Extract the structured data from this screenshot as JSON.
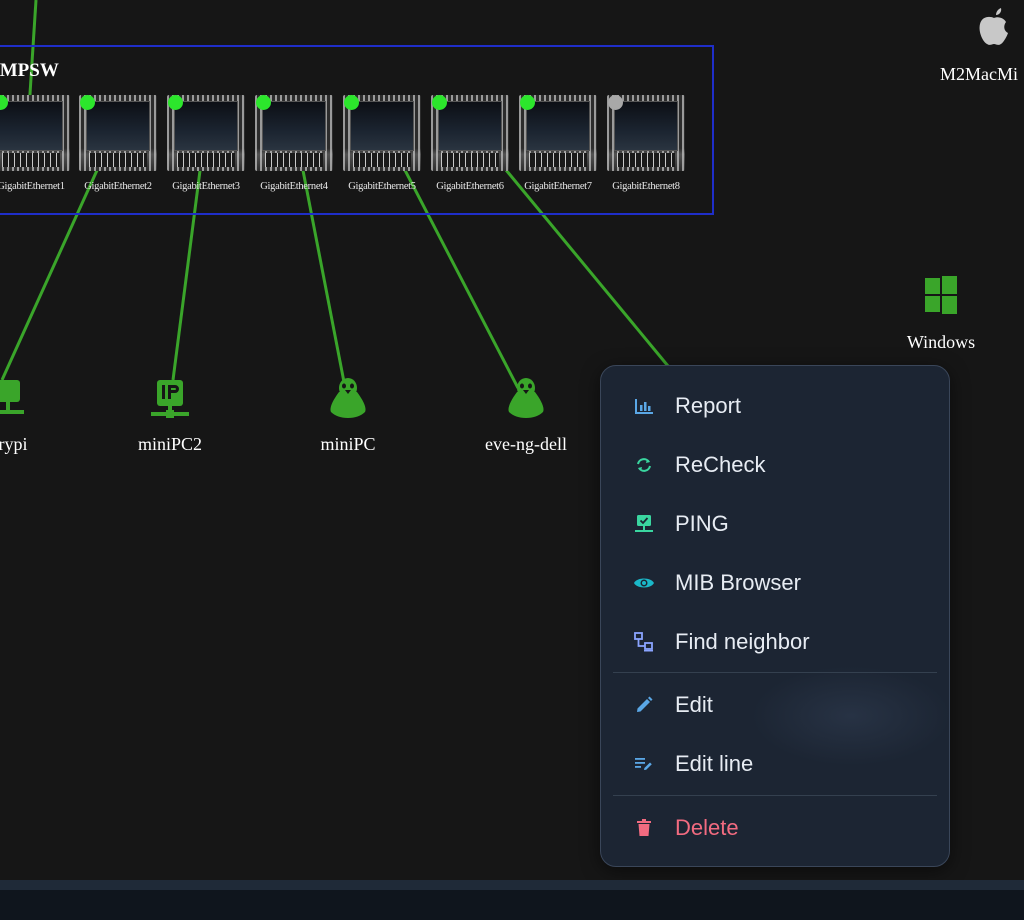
{
  "switch": {
    "title": "NMPSW",
    "ports": [
      {
        "name": "GigabitEthernet1",
        "status": "up"
      },
      {
        "name": "GigabitEthernet2",
        "status": "up"
      },
      {
        "name": "GigabitEthernet3",
        "status": "up"
      },
      {
        "name": "GigabitEthernet4",
        "status": "up"
      },
      {
        "name": "GigabitEthernet5",
        "status": "up"
      },
      {
        "name": "GigabitEthernet6",
        "status": "up"
      },
      {
        "name": "GigabitEthernet7",
        "status": "up"
      },
      {
        "name": "GigabitEthernet8",
        "status": "down"
      }
    ]
  },
  "nodes": {
    "mac": {
      "label": "M2MacMi",
      "icon": "apple-icon"
    },
    "windows": {
      "label": "Windows",
      "icon": "windows-icon"
    },
    "raspberry": {
      "label": "rrypi",
      "icon": "monitor-network-icon"
    },
    "minipc2": {
      "label": "miniPC2",
      "icon": "ip-network-icon"
    },
    "minipc": {
      "label": "miniPC",
      "icon": "linux-penguin-icon"
    },
    "eve": {
      "label": "eve-ng-dell",
      "icon": "linux-penguin-icon"
    }
  },
  "context_menu": {
    "items": [
      {
        "label": "Report",
        "icon": "chart-bar-icon"
      },
      {
        "label": "ReCheck",
        "icon": "refresh-icon"
      },
      {
        "label": "PING",
        "icon": "ping-monitor-icon"
      },
      {
        "label": "MIB Browser",
        "icon": "eye-icon"
      },
      {
        "label": "Find neighbor",
        "icon": "lan-icon"
      },
      {
        "label": "Edit",
        "icon": "pencil-icon"
      },
      {
        "label": "Edit line",
        "icon": "edit-line-icon"
      },
      {
        "label": "Delete",
        "icon": "trash-icon"
      }
    ]
  },
  "colors": {
    "background": "#161616",
    "link": "#3aa52a",
    "led_up": "#2ce62c",
    "led_down": "#a8a8a8",
    "switch_border": "#1f2ec9",
    "menu_bg": "#1c2533",
    "menu_text": "#e7ecf3",
    "delete": "#f26b80",
    "icon_blue": "#5aa7e6",
    "icon_green": "#3ad6a0",
    "icon_teal": "#1ab8c9",
    "icon_lavender": "#8aa4ff"
  }
}
